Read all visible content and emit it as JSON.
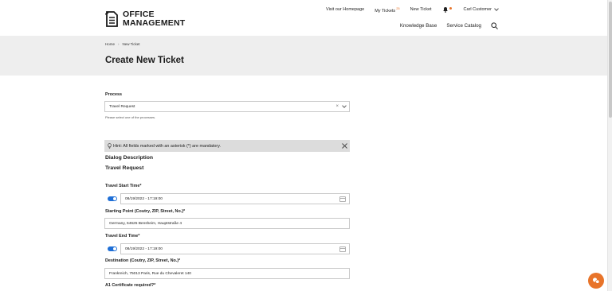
{
  "brand": {
    "line1": "OFFICE",
    "line2": "MANAGEMENT"
  },
  "topnav": {
    "homepage": "Visit our Homepage",
    "my_tickets": "My Tickets",
    "my_tickets_badge": "25",
    "new_ticket": "New Ticket",
    "user": "Carl Customer"
  },
  "mainnav": {
    "knowledge_base": "Knowledge Base",
    "service_catalog": "Service Catalog"
  },
  "breadcrumb": {
    "home": "Home",
    "current": "New Ticket"
  },
  "page_title": "Create New Ticket",
  "form": {
    "process_label": "Process",
    "process_value": "Travel Request",
    "process_help": "Please select one of the processes.",
    "hint": "Hint: All fields marked with an asterisk (*) are mandatory.",
    "dialog_description": "Dialog Description",
    "dialog_name": "Travel Request",
    "start_time_label": "Travel Start Time*",
    "start_time_value": "08/19/2022 - 17:19:00",
    "start_point_label": "Starting Point (Coutry, ZIP, Street, No.)*",
    "start_point_value": "Germany, 64625 Bensheim, Hauptstraße 4",
    "end_time_label": "Travel End Time*",
    "end_time_value": "08/19/2022 - 17:19:00",
    "destination_label": "Destination (Coutry, ZIP, Street, No.)*",
    "destination_value": "Frankreich, 75013 Paris,  Rue du Chevaleret 140",
    "a1_label": "A1 Certificate required?*"
  },
  "colors": {
    "accent": "#e8742a",
    "toggle": "#1f6fd6",
    "banner": "#eeeeee"
  },
  "icons": [
    "logo-icon",
    "bell-icon",
    "chevron-down-icon",
    "search-icon",
    "close-icon",
    "calendar-icon",
    "chat-icon"
  ]
}
